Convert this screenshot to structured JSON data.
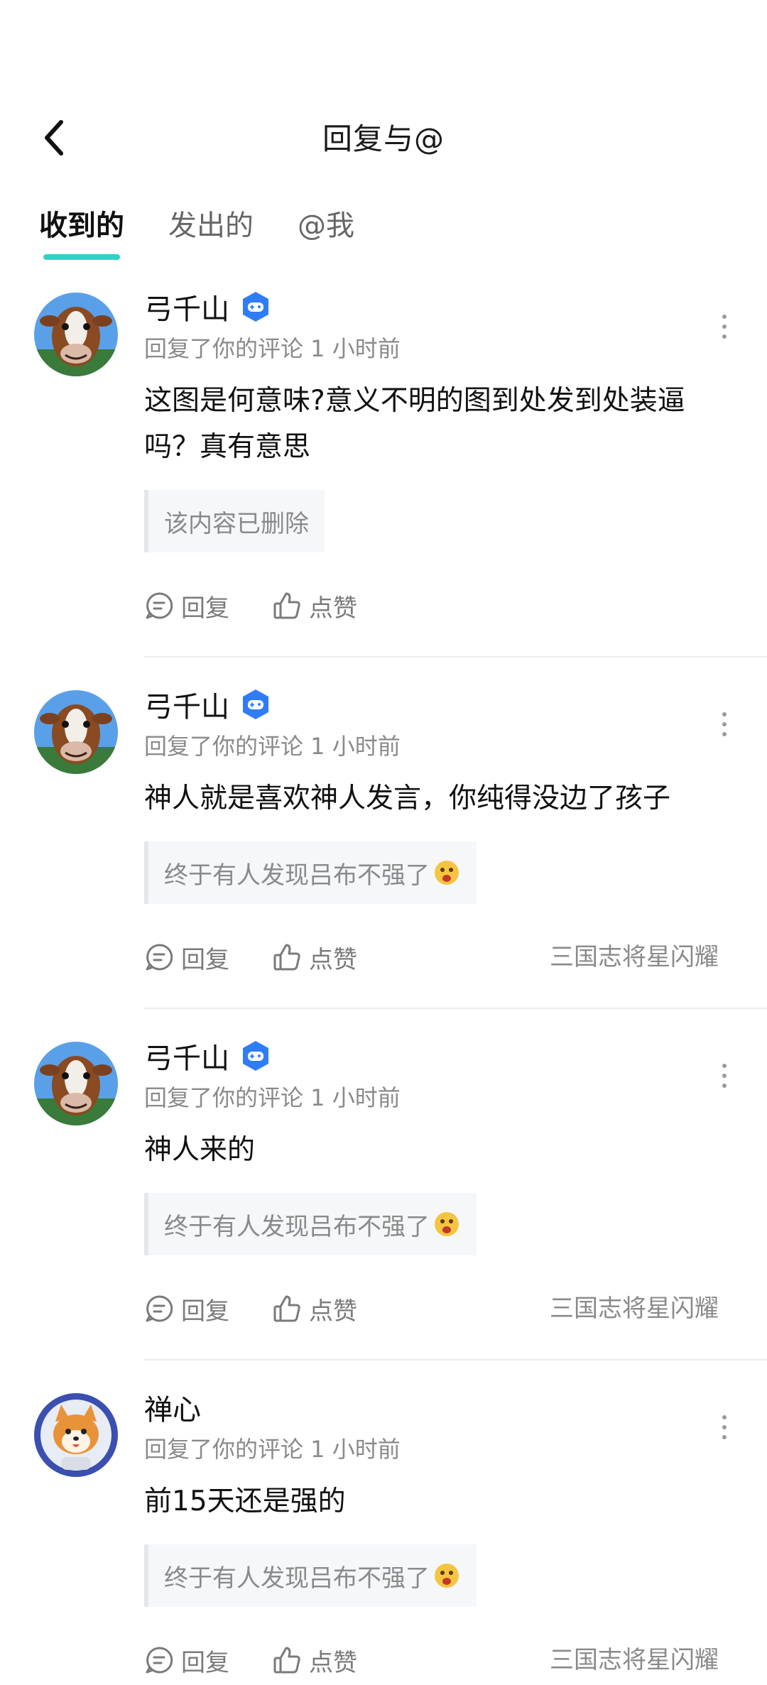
{
  "header": {
    "title": "回复与@"
  },
  "tabs": [
    {
      "label": "收到的",
      "active": true
    },
    {
      "label": "发出的",
      "active": false
    },
    {
      "label": "@我",
      "active": false
    }
  ],
  "colors": {
    "tab_underline": "#2ed3c6",
    "badge_blue": "#2f7df6"
  },
  "items": [
    {
      "name": "弓千山",
      "has_badge": true,
      "meta": "回复了你的评论 1 小时前",
      "text": "这图是何意味?意义不明的图到处发到处装逼吗？真有意思",
      "quote": "该内容已删除",
      "reply_label": "回复",
      "like_label": "点赞",
      "source": ""
    },
    {
      "name": "弓千山",
      "has_badge": true,
      "meta": "回复了你的评论 1 小时前",
      "text": "神人就是喜欢神人发言，你纯得没边了孩子",
      "quote": "终于有人发现吕布不强了",
      "reply_label": "回复",
      "like_label": "点赞",
      "source": "三国志将星闪耀"
    },
    {
      "name": "弓千山",
      "has_badge": true,
      "meta": "回复了你的评论 1 小时前",
      "text": "神人来的",
      "quote": "终于有人发现吕布不强了",
      "reply_label": "回复",
      "like_label": "点赞",
      "source": "三国志将星闪耀"
    },
    {
      "name": "禅心",
      "has_badge": false,
      "meta": "回复了你的评论 1 小时前",
      "text": "前15天还是强的",
      "quote": "终于有人发现吕布不强了",
      "reply_label": "回复",
      "like_label": "点赞",
      "source": "三国志将星闪耀"
    }
  ]
}
